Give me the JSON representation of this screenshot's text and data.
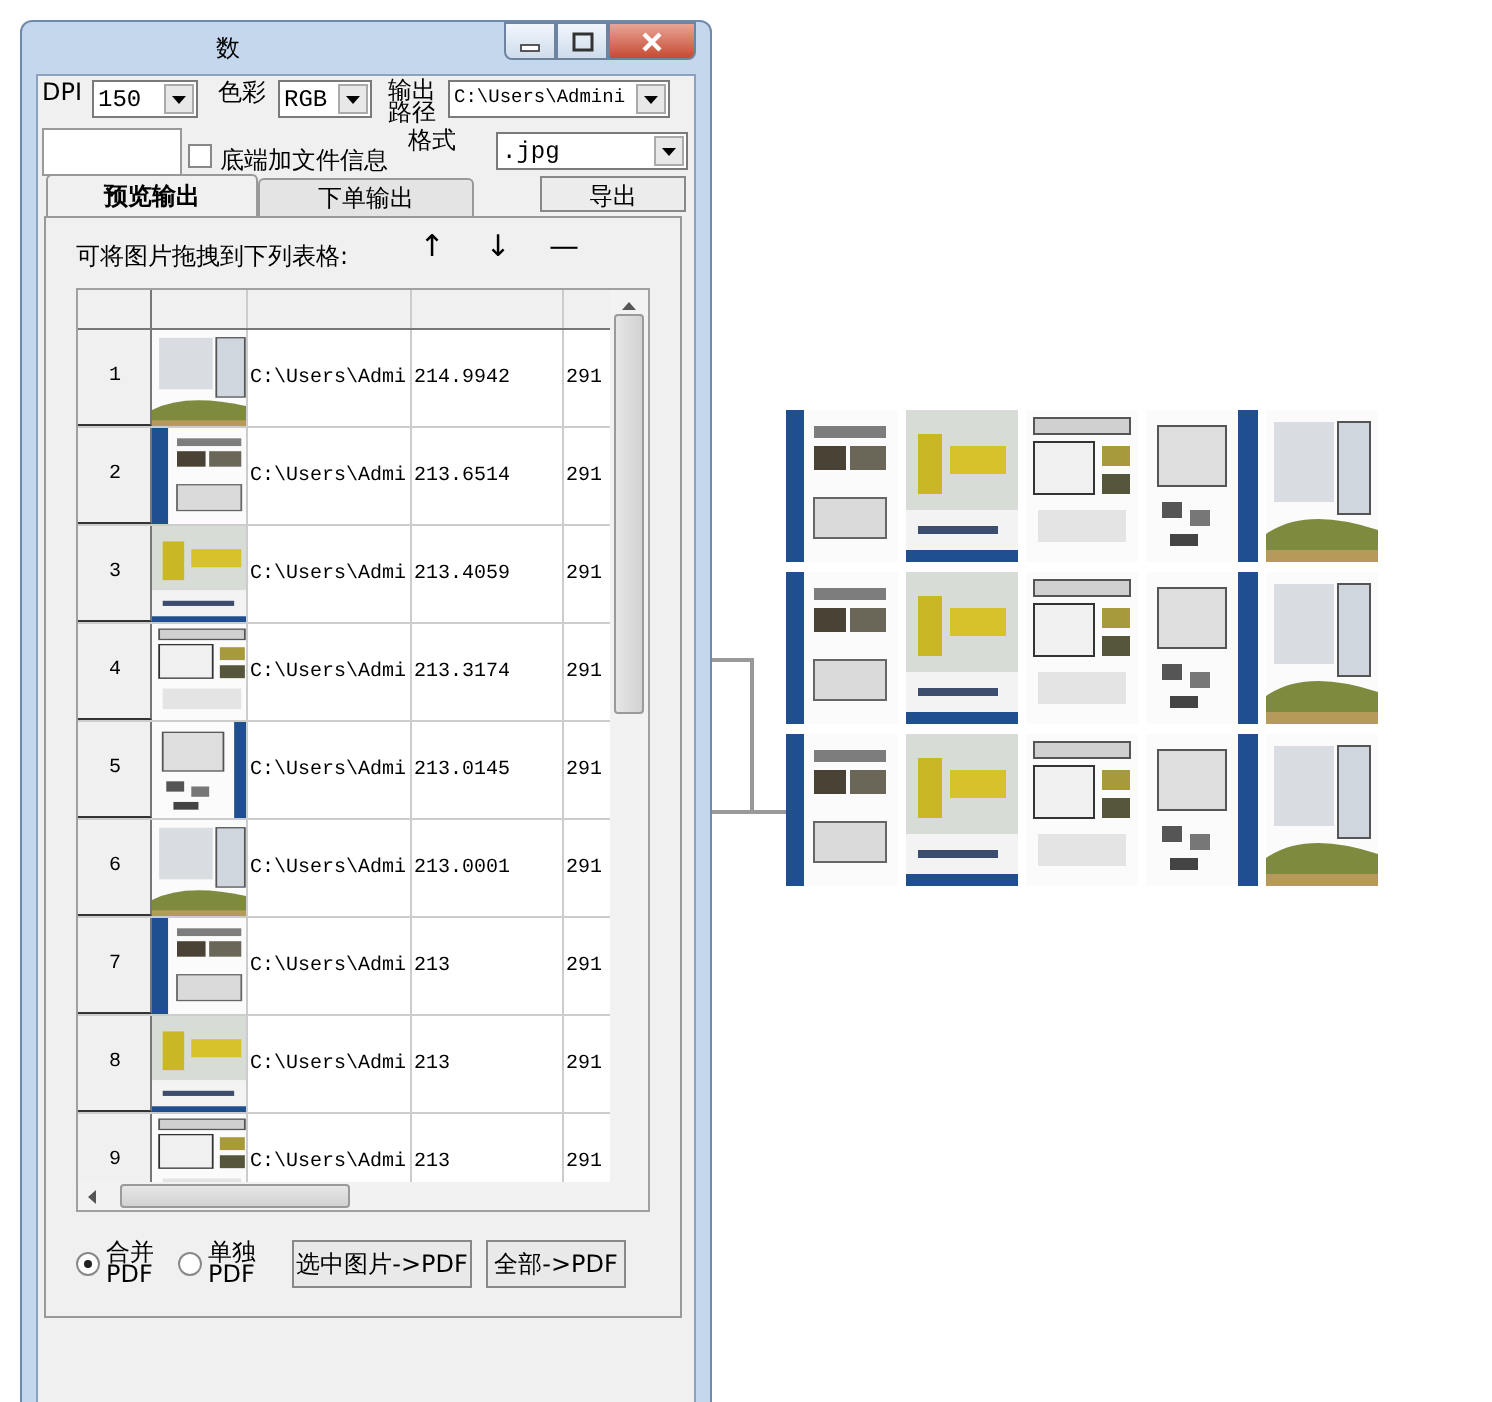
{
  "window": {
    "title": "数"
  },
  "settings": {
    "dpi_label": "DPI",
    "dpi": "150",
    "color_label": "色彩",
    "color_mode": "RGB",
    "output_path_label": [
      "输出",
      "路径"
    ],
    "output_path": "C:\\Users\\Admini",
    "format_label": "格式",
    "format": ".jpg",
    "file_info": {
      "label": "底端加文件信息",
      "checked": false
    },
    "export_button": "导出"
  },
  "tabs": [
    {
      "label": "预览输出",
      "selected": true
    },
    {
      "label": "下单输出",
      "selected": false
    }
  ],
  "drag_hint": "可将图片拖拽到下列表格:",
  "move_buttons": [
    "↑",
    "↓",
    "—"
  ],
  "table": {
    "rows": [
      {
        "index": "1",
        "thumbnail": {
          "kind": "picture"
        },
        "path": "C:\\Users\\Admi",
        "column_4": "214.9942",
        "column_5": "291"
      },
      {
        "index": "2",
        "thumbnail": {
          "kind": "picture"
        },
        "path": "C:\\Users\\Admi",
        "column_4": "213.6514",
        "column_5": "291"
      },
      {
        "index": "3",
        "thumbnail": {
          "kind": "picture"
        },
        "path": "C:\\Users\\Admi",
        "column_4": "213.4059",
        "column_5": "291"
      },
      {
        "index": "4",
        "thumbnail": {
          "kind": "picture"
        },
        "path": "C:\\Users\\Admi",
        "column_4": "213.3174",
        "column_5": "291"
      },
      {
        "index": "5",
        "thumbnail": {
          "kind": "picture"
        },
        "path": "C:\\Users\\Admi",
        "column_4": "213.0145",
        "column_5": "291"
      },
      {
        "index": "6",
        "thumbnail": {
          "kind": "picture"
        },
        "path": "C:\\Users\\Admi",
        "column_4": "213.0001",
        "column_5": "291"
      },
      {
        "index": "7",
        "thumbnail": {
          "kind": "picture"
        },
        "path": "C:\\Users\\Admi",
        "column_4": "213",
        "column_5": "291"
      },
      {
        "index": "8",
        "thumbnail": {
          "kind": "picture"
        },
        "path": "C:\\Users\\Admi",
        "column_4": "213",
        "column_5": "291"
      },
      {
        "index": "9",
        "thumbnail": {
          "kind": "picture"
        },
        "path": "C:\\Users\\Admi",
        "column_4": "213",
        "column_5": "291"
      }
    ]
  },
  "pdf_mode": [
    {
      "label": [
        "合并",
        "PDF"
      ],
      "selected": true
    },
    {
      "label": [
        "单独",
        "PDF"
      ],
      "selected": false
    }
  ],
  "pdf_buttons": [
    "选中图片->PDF",
    "全部->PDF"
  ],
  "preview_pages": [
    {
      "kind": "picture"
    },
    {
      "kind": "picture"
    },
    {
      "kind": "picture"
    },
    {
      "kind": "picture"
    },
    {
      "kind": "picture"
    },
    {
      "kind": "picture"
    },
    {
      "kind": "picture"
    },
    {
      "kind": "picture"
    },
    {
      "kind": "picture"
    },
    {
      "kind": "picture"
    },
    {
      "kind": "picture"
    },
    {
      "kind": "picture"
    },
    {
      "kind": "picture"
    },
    {
      "kind": "picture"
    },
    {
      "kind": "picture"
    }
  ]
}
